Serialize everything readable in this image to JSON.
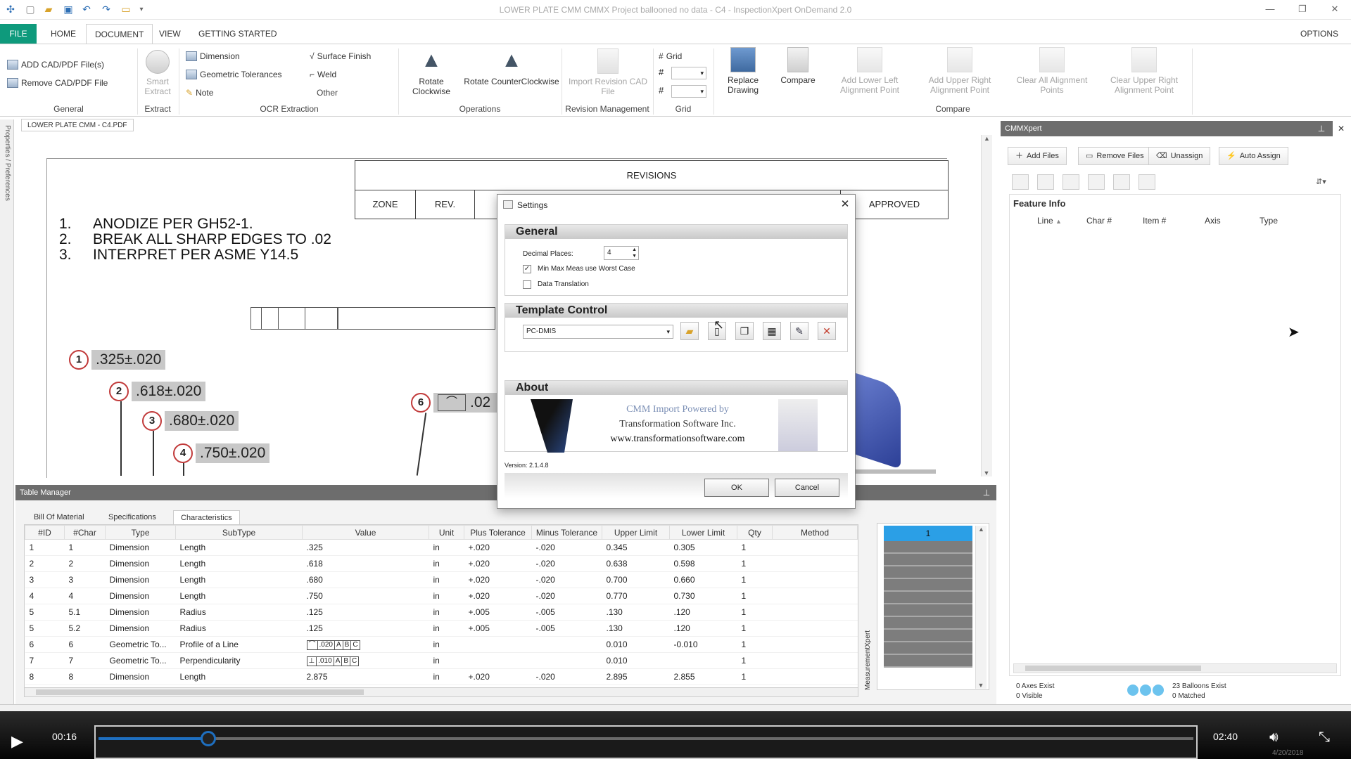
{
  "window": {
    "title": "LOWER PLATE CMM CMMX Project ballooned no data - C4 - InspectionXpert OnDemand 2.0"
  },
  "menu": {
    "tabs": [
      "FILE",
      "HOME",
      "DOCUMENT",
      "VIEW",
      "GETTING STARTED"
    ],
    "active_tab": "DOCUMENT",
    "options_label": "OPTIONS"
  },
  "ribbon": {
    "general": {
      "label": "General",
      "add_files": "ADD CAD/PDF File(s)",
      "remove_file": "Remove CAD/PDF File"
    },
    "extract": {
      "label": "Extract",
      "smart_extract_1": "Smart",
      "smart_extract_2": "Extract"
    },
    "ocr": {
      "label": "OCR Extraction",
      "dimension": "Dimension",
      "geometric_tolerances": "Geometric Tolerances",
      "note": "Note"
    },
    "other": {
      "label": "Other",
      "surface_finish": "Surface Finish",
      "weld": "Weld"
    },
    "operations": {
      "label": "Operations",
      "rotate_cw_1": "Rotate",
      "rotate_cw_2": "Clockwise",
      "rotate_ccw": "Rotate CounterClockwise"
    },
    "revision": {
      "label": "Revision Management",
      "import_1": "Import Revision CAD",
      "import_2": "File"
    },
    "grid": {
      "label": "Grid",
      "grid_toggle": "Grid"
    },
    "compare": {
      "label": "Compare",
      "replace_1": "Replace",
      "replace_2": "Drawing",
      "compare": "Compare",
      "add_lower_left_1": "Add Lower Left",
      "add_lower_left_2": "Alignment Point",
      "add_upper_right_1": "Add Upper Right",
      "add_upper_right_2": "Alignment Point",
      "clear_all_1": "Clear All Alignment",
      "clear_all_2": "Points",
      "clear_upper_right_1": "Clear Upper Right",
      "clear_upper_right_2": "Alignment Point"
    }
  },
  "side_panel_label": "Properties / Preferences",
  "document": {
    "tab": "LOWER PLATE CMM - C4.PDF",
    "revisions_header": "REVISIONS",
    "rev_cols": [
      "ZONE",
      "REV.",
      "APPROVED"
    ],
    "notes": [
      {
        "n": "1.",
        "text": "ANODIZE PER GH52-1."
      },
      {
        "n": "2.",
        "text": "BREAK ALL SHARP EDGES TO .02"
      },
      {
        "n": "3.",
        "text": "INTERPRET PER ASME Y14.5"
      }
    ],
    "balloons": [
      {
        "num": "1",
        "dim": ".325±.020"
      },
      {
        "num": "2",
        "dim": ".618±.020"
      },
      {
        "num": "3",
        "dim": ".680±.020"
      },
      {
        "num": "4",
        "dim": ".750±.020"
      },
      {
        "num": "6",
        "dim": ".02"
      }
    ]
  },
  "table_manager": {
    "title": "Table Manager",
    "tabs": [
      "Bill Of Material",
      "Specifications",
      "Characteristics"
    ],
    "active_tab": "Characteristics",
    "columns": [
      "#ID",
      "#Char",
      "Type",
      "SubType",
      "Value",
      "Unit",
      "Plus Tolerance",
      "Minus Tolerance",
      "Upper Limit",
      "Lower Limit",
      "Qty",
      "Method"
    ],
    "rows": [
      {
        "id": "1",
        "char": "1",
        "type": "Dimension",
        "subtype": "Length",
        "value": ".325",
        "unit": "in",
        "plus": "+.020",
        "minus": "-.020",
        "upper": "0.345",
        "lower": "0.305",
        "qty": "1"
      },
      {
        "id": "2",
        "char": "2",
        "type": "Dimension",
        "subtype": "Length",
        "value": ".618",
        "unit": "in",
        "plus": "+.020",
        "minus": "-.020",
        "upper": "0.638",
        "lower": "0.598",
        "qty": "1"
      },
      {
        "id": "3",
        "char": "3",
        "type": "Dimension",
        "subtype": "Length",
        "value": ".680",
        "unit": "in",
        "plus": "+.020",
        "minus": "-.020",
        "upper": "0.700",
        "lower": "0.660",
        "qty": "1"
      },
      {
        "id": "4",
        "char": "4",
        "type": "Dimension",
        "subtype": "Length",
        "value": ".750",
        "unit": "in",
        "plus": "+.020",
        "minus": "-.020",
        "upper": "0.770",
        "lower": "0.730",
        "qty": "1"
      },
      {
        "id": "5",
        "char": "5.1",
        "type": "Dimension",
        "subtype": "Radius",
        "value": ".125",
        "unit": "in",
        "plus": "+.005",
        "minus": "-.005",
        "upper": ".130",
        "lower": ".120",
        "qty": "1"
      },
      {
        "id": "5",
        "char": "5.2",
        "type": "Dimension",
        "subtype": "Radius",
        "value": ".125",
        "unit": "in",
        "plus": "+.005",
        "minus": "-.005",
        "upper": ".130",
        "lower": ".120",
        "qty": "1"
      },
      {
        "id": "6",
        "char": "6",
        "type": "Geometric To...",
        "subtype": "Profile of a Line",
        "value": "",
        "fcf": [
          "⌒",
          ".020",
          "A",
          "B",
          "C"
        ],
        "unit": "in",
        "plus": "",
        "minus": "",
        "upper": "0.010",
        "lower": "-0.010",
        "qty": "1"
      },
      {
        "id": "7",
        "char": "7",
        "type": "Geometric To...",
        "subtype": "Perpendicularity",
        "value": "",
        "fcf": [
          "⊥",
          ".010",
          "A",
          "B",
          "C"
        ],
        "unit": "in",
        "plus": "",
        "minus": "",
        "upper": "0.010",
        "lower": "",
        "qty": "1"
      },
      {
        "id": "8",
        "char": "8",
        "type": "Dimension",
        "subtype": "Length",
        "value": "2.875",
        "unit": "in",
        "plus": "+.020",
        "minus": "-.020",
        "upper": "2.895",
        "lower": "2.855",
        "qty": "1"
      }
    ],
    "side_label": "MeasurementXpert",
    "mini_selected": "1"
  },
  "cmm": {
    "title": "CMMXpert",
    "buttons": [
      "Add Files",
      "Remove Files",
      "Unassign",
      "Auto Assign"
    ],
    "feature_info": "Feature Info",
    "columns": [
      "Line",
      "Char #",
      "Item #",
      "Axis",
      "Type"
    ],
    "status_axes": "0 Axes Exist",
    "status_visible": "0 Visible",
    "status_balloons": "23 Balloons Exist",
    "status_matched": "0 Matched"
  },
  "settings": {
    "title": "Settings",
    "general": "General",
    "decimal_label": "Decimal Places:",
    "decimal_value": "4",
    "minmax_label": "Min Max Meas use Worst Case",
    "minmax_checked": "✓",
    "data_translation_label": "Data Translation",
    "template_control": "Template Control",
    "template_value": "PC-DMIS",
    "about": "About",
    "about_line1": "CMM Import Powered by",
    "about_line2": "Transformation Software Inc.",
    "about_line3": "www.transformationsoftware.com",
    "version": "Version: 2.1.4.8",
    "ok": "OK",
    "cancel": "Cancel"
  },
  "player": {
    "elapsed": "00:16",
    "duration": "02:40",
    "progress": 0.1,
    "date": "4/20/2018"
  },
  "colors": {
    "file_tab": "#0e9a7c",
    "balloon_ring": "#c13a3a",
    "selected_cell": "#2b9fe6",
    "player_bar": "#1e6fc0"
  }
}
